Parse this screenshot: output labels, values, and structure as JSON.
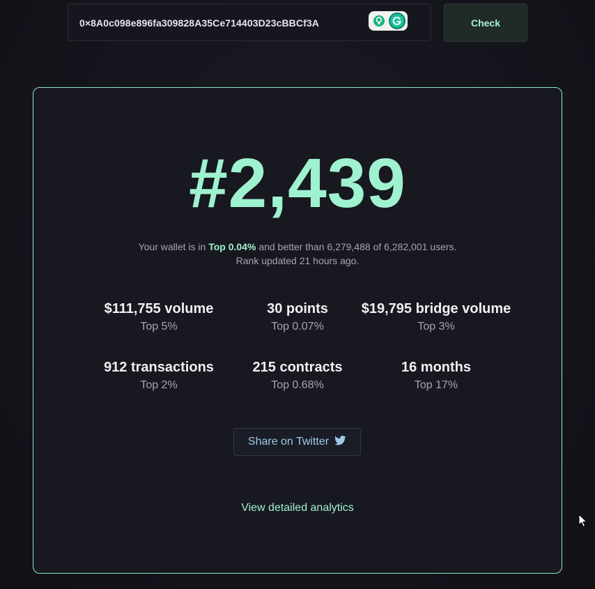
{
  "search": {
    "address_value": "0×8A0c098e896fa309828A35Ce714403D23cBBCf3A",
    "check_label": "Check"
  },
  "result": {
    "rank": "#2,439",
    "summary_prefix": "Your wallet is in",
    "summary_top": "Top 0.04%",
    "summary_suffix": "and better than 6,279,488 of 6,282,001 users.",
    "updated": "Rank updated 21 hours ago.",
    "stats": [
      {
        "value": "$111,755 volume",
        "rank": "Top 5%"
      },
      {
        "value": "30 points",
        "rank": "Top 0.07%"
      },
      {
        "value": "$19,795 bridge volume",
        "rank": "Top 3%"
      },
      {
        "value": "912 transactions",
        "rank": "Top 2%"
      },
      {
        "value": "215 contracts",
        "rank": "Top 0.68%"
      },
      {
        "value": "16 months",
        "rank": "Top 17%"
      }
    ],
    "share_label": "Share on Twitter",
    "analytics_label": "View detailed analytics"
  },
  "icons": {
    "extension_1": "lightbulb-icon",
    "extension_2": "grammarly-icon",
    "share": "twitter-icon",
    "cursor": "mouse-cursor-icon"
  },
  "colors": {
    "accent": "#9ff2cf",
    "card_border": "#8fe8c4",
    "background": "#15151d",
    "twitter": "#9ecbe6"
  }
}
